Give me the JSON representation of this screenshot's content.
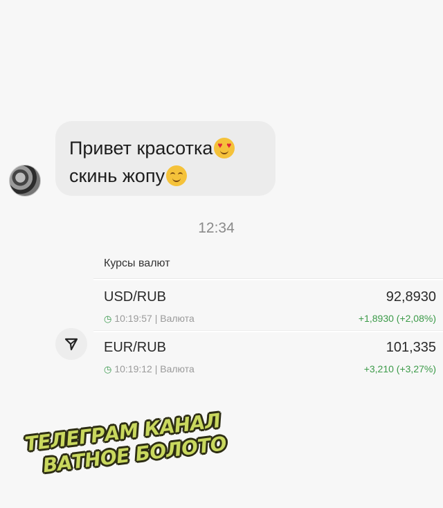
{
  "message": {
    "line1": "Привет красотка",
    "line1_emoji": "heart-eyes-emoji",
    "line2": "скинь жопу",
    "line2_emoji": "smirk-emoji"
  },
  "timestamp": "12:34",
  "rates_card": {
    "title": "Курсы валют",
    "rows": [
      {
        "pair": "USD/RUB",
        "time": "10:19:57 | Валюта",
        "price": "92,8930",
        "change": "+1,8930 (+2,08%)"
      },
      {
        "pair": "EUR/RUB",
        "time": "10:19:12 | Валюта",
        "price": "101,335",
        "change": "+3,210 (+3,27%)"
      }
    ]
  },
  "watermark": {
    "line1": "ТЕЛЕГРАМ КАНАЛ",
    "line2": "ВАТНОЕ БОЛОТО"
  },
  "colors": {
    "positive": "#3b9a48",
    "bubble": "#ececec",
    "watermark": "#c9d85e"
  }
}
